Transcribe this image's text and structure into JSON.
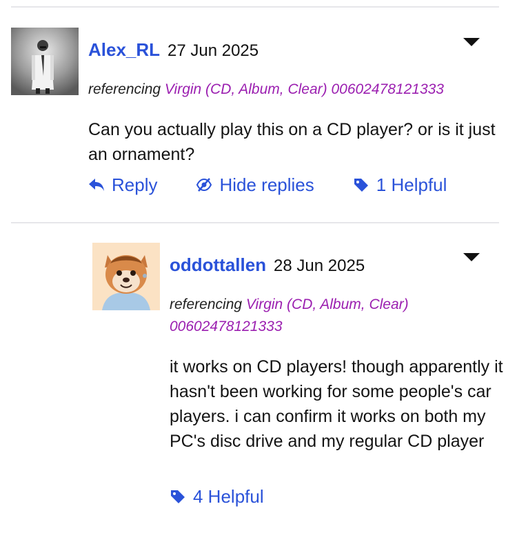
{
  "comments": [
    {
      "username": "Alex_RL",
      "date": "27 Jun 2025",
      "referencing_label": "referencing",
      "release": "Virgin (CD, Album, Clear) 00602478121333",
      "body": "Can you actually play this on a CD player? or is it just an ornament?",
      "actions": {
        "reply": "Reply",
        "hide_replies": "Hide replies",
        "helpful": "1 Helpful"
      }
    },
    {
      "username": "oddottallen",
      "date": "28 Jun 2025",
      "referencing_label": "referencing",
      "release": "Virgin (CD, Album, Clear) 00602478121333",
      "body": "it works on CD players! though apparently it hasn't been working for some people's car players. i can confirm it works on both my PC's disc drive and my regular CD player",
      "actions": {
        "helpful": "4 Helpful"
      }
    }
  ],
  "colors": {
    "link": "#2a52d9",
    "release": "#9b1fb0",
    "divider": "#e6e6ea"
  },
  "icons": {
    "menu": "caret-down-icon",
    "reply": "reply-arrow-icon",
    "hide": "eye-slash-icon",
    "helpful": "tag-icon"
  }
}
